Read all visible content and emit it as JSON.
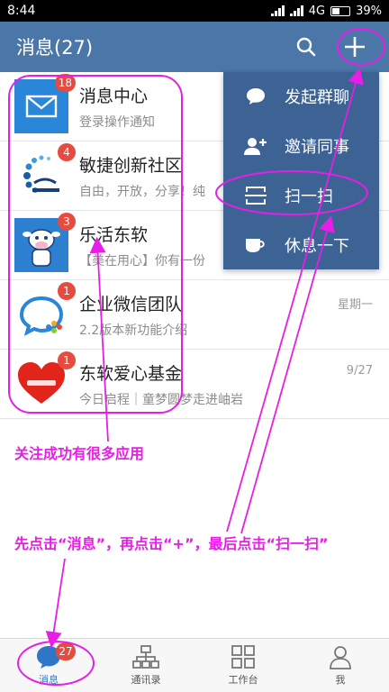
{
  "status": {
    "time": "8:44",
    "network": "4G",
    "battery": "39%"
  },
  "header": {
    "title": "消息(27)",
    "search_icon": "search-icon",
    "add_icon": "plus-icon"
  },
  "conversations": [
    {
      "title": "消息中心",
      "subtitle": "登录操作通知",
      "badge": "18",
      "time": "",
      "icon": "mail-icon"
    },
    {
      "title": "敏捷创新社区",
      "subtitle": "自由，开放，分享！纯",
      "badge": "4",
      "time": "",
      "icon": "community-logo"
    },
    {
      "title": "乐活东软",
      "subtitle": "【美在用心】你有一份",
      "badge": "3",
      "time": "",
      "icon": "cow-mascot"
    },
    {
      "title": "企业微信团队",
      "subtitle": "2.2版本新功能介绍",
      "badge": "1",
      "time": "星期一",
      "icon": "chat-bubble-logo"
    },
    {
      "title": "东软爱心基金",
      "subtitle": "今日启程｜童梦圆梦走进岫岩",
      "badge": "1",
      "time": "9/27",
      "icon": "heart-logo"
    }
  ],
  "popup_menu": [
    {
      "label": "发起群聊",
      "icon": "chat-icon"
    },
    {
      "label": "邀请同事",
      "icon": "add-person-icon"
    },
    {
      "label": "扫一扫",
      "icon": "scan-icon"
    },
    {
      "label": "休息一下",
      "icon": "cup-icon"
    }
  ],
  "tabs": [
    {
      "label": "消息",
      "badge": "27",
      "icon": "message-icon"
    },
    {
      "label": "通讯录",
      "icon": "org-chart-icon"
    },
    {
      "label": "工作台",
      "icon": "grid-icon"
    },
    {
      "label": "我",
      "icon": "person-icon"
    }
  ],
  "annotations": {
    "apps_note": "关注成功有很多应用",
    "instruction": "先点击“消息”，再点击“+”，最后点击“扫一扫”"
  },
  "colors": {
    "header": "#4a76a8",
    "popup": "#3d6394",
    "badge": "#e64b40",
    "annotation": "#e61ee6",
    "active_tab": "#2f77c6"
  }
}
